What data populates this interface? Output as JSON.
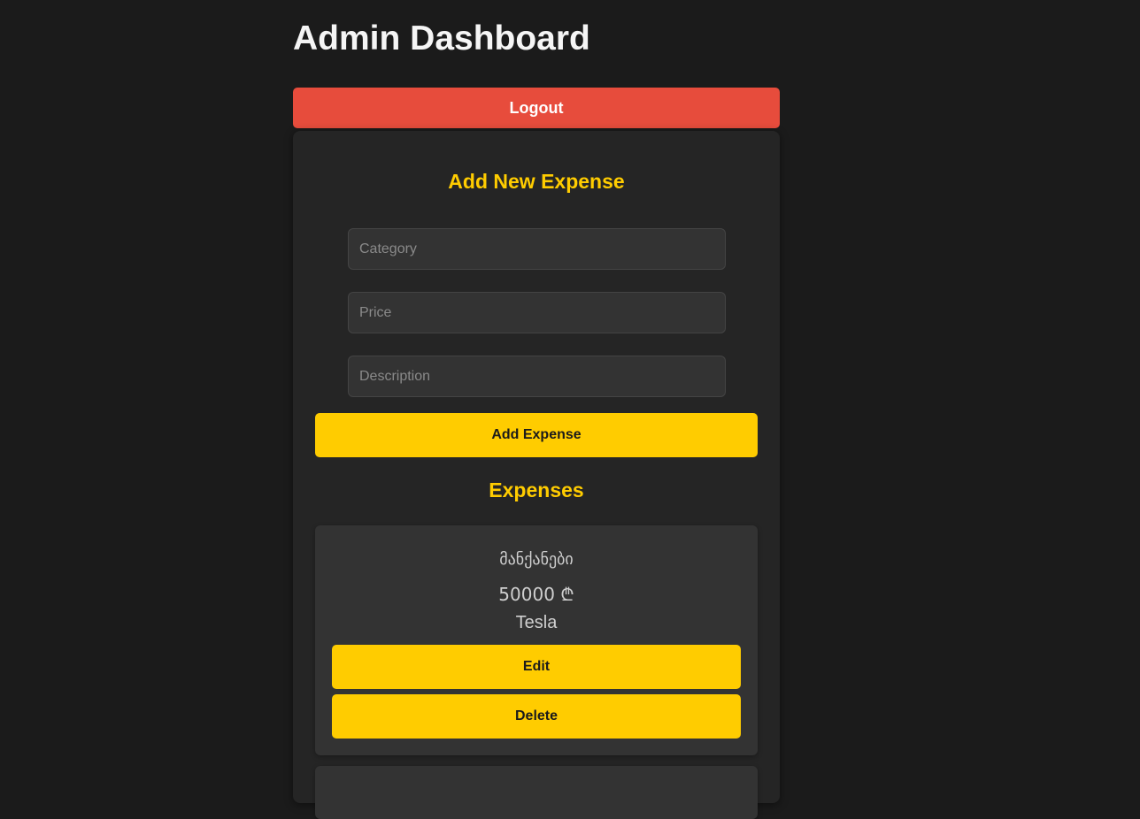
{
  "header": {
    "title": "Admin Dashboard",
    "logout_label": "Logout"
  },
  "form": {
    "title": "Add New Expense",
    "category_placeholder": "Category",
    "price_placeholder": "Price",
    "description_placeholder": "Description",
    "submit_label": "Add Expense"
  },
  "expenses": {
    "title": "Expenses",
    "items": [
      {
        "category": "მანქანები",
        "price": "50000 ₾",
        "description": "Tesla",
        "edit_label": "Edit",
        "delete_label": "Delete"
      }
    ]
  },
  "colors": {
    "background": "#1b1b1b",
    "panel": "#252525",
    "accent": "#ffcc00",
    "danger": "#e74c3c"
  }
}
